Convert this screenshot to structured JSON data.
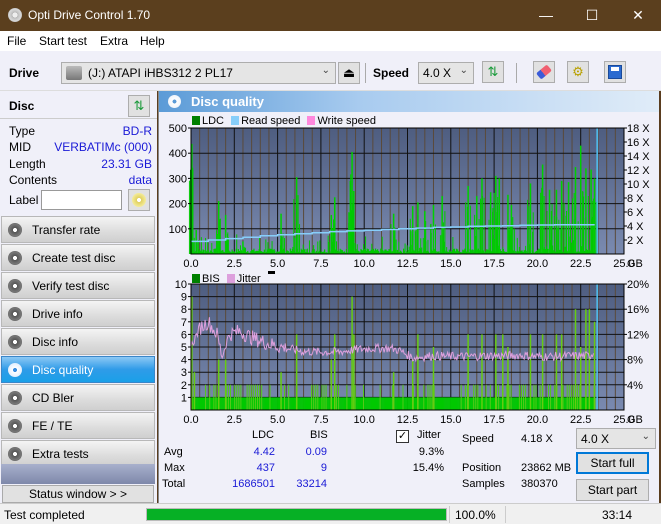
{
  "window": {
    "title": "Opti Drive Control 1.70",
    "controls": {
      "minimize": "—",
      "maximize": "☐",
      "close": "✕"
    }
  },
  "menu": [
    "File",
    "Start test",
    "Extra",
    "Help"
  ],
  "toolbar": {
    "drive_label": "Drive",
    "drive_value": "(J:)  ATAPI iHBS312   2 PL17",
    "eject_icon": "⏏",
    "speed_label": "Speed",
    "speed_value": "4.0 X",
    "icons": [
      "refresh-icon",
      "eraser-icon",
      "settings-icon",
      "save-icon"
    ]
  },
  "disc": {
    "header": "Disc",
    "rows": [
      {
        "key": "Type",
        "value": "BD-R"
      },
      {
        "key": "MID",
        "value": "VERBATIMc (000)"
      },
      {
        "key": "Length",
        "value": "23.31 GB"
      },
      {
        "key": "Contents",
        "value": "data"
      }
    ],
    "label_key": "Label",
    "label_value": ""
  },
  "nav": [
    {
      "label": "Transfer rate",
      "active": false
    },
    {
      "label": "Create test disc",
      "active": false
    },
    {
      "label": "Verify test disc",
      "active": false
    },
    {
      "label": "Drive info",
      "active": false
    },
    {
      "label": "Disc info",
      "active": false
    },
    {
      "label": "Disc quality",
      "active": true
    },
    {
      "label": "CD Bler",
      "active": false
    },
    {
      "label": "FE / TE",
      "active": false
    },
    {
      "label": "Extra tests",
      "active": false
    }
  ],
  "status_window_button": "Status window > >",
  "panel": {
    "title": "Disc quality",
    "legend_top": [
      {
        "label": "LDC",
        "color": "#008000"
      },
      {
        "label": "Read speed",
        "color": "#87cefa"
      },
      {
        "label": "Write speed",
        "color": "#ff88dd"
      }
    ],
    "legend_bottom": [
      {
        "label": "BIS",
        "color": "#008000"
      },
      {
        "label": "Jitter",
        "color": "#dda0dd"
      }
    ]
  },
  "chart_data": [
    {
      "type": "bar",
      "title": "LDC / Read speed",
      "xlabel": "GB",
      "x_ticks": [
        "0.0",
        "2.5",
        "5.0",
        "7.5",
        "10.0",
        "12.5",
        "15.0",
        "17.5",
        "20.0",
        "22.5",
        "25.0"
      ],
      "xlim": [
        0,
        25
      ],
      "ylim": [
        0,
        500
      ],
      "y_ticks": [
        "100",
        "200",
        "300",
        "400",
        "500"
      ],
      "y2_ticks": [
        "2 X",
        "4 X",
        "6 X",
        "8 X",
        "10 X",
        "12 X",
        "14 X",
        "16 X",
        "18 X"
      ],
      "y2lim": [
        0,
        18
      ],
      "grid": true,
      "series": [
        {
          "name": "LDC",
          "color": "#00c800",
          "peaks": [
            [
              0.05,
              437
            ],
            [
              0.3,
              95
            ],
            [
              1.6,
              210
            ],
            [
              2.0,
              155
            ],
            [
              3.0,
              50
            ],
            [
              5.2,
              160
            ],
            [
              6.1,
              305
            ],
            [
              8.1,
              155
            ],
            [
              8.3,
              225
            ],
            [
              9.2,
              290
            ],
            [
              9.3,
              405
            ],
            [
              9.4,
              250
            ],
            [
              11.7,
              160
            ],
            [
              12.8,
              190
            ],
            [
              13.1,
              205
            ],
            [
              13.5,
              170
            ],
            [
              14.0,
              195
            ],
            [
              14.5,
              230
            ],
            [
              16.0,
              270
            ],
            [
              16.5,
              230
            ],
            [
              16.8,
              300
            ],
            [
              17.3,
              245
            ],
            [
              17.6,
              310
            ],
            [
              17.8,
              300
            ],
            [
              18.3,
              235
            ],
            [
              18.5,
              195
            ],
            [
              19.6,
              280
            ],
            [
              20.3,
              355
            ],
            [
              20.7,
              255
            ],
            [
              21.1,
              255
            ],
            [
              21.4,
              290
            ],
            [
              21.8,
              285
            ],
            [
              22.2,
              345
            ],
            [
              22.5,
              430
            ],
            [
              22.8,
              340
            ],
            [
              23.1,
              335
            ],
            [
              23.3,
              300
            ]
          ],
          "baseline": 10
        },
        {
          "name": "Read speed",
          "color": "#87cefa",
          "unit": "X",
          "x": [
            0,
            1,
            2,
            3,
            4,
            5,
            6,
            7,
            8,
            9,
            10,
            11,
            12,
            13,
            14,
            15,
            16,
            17,
            18,
            19,
            20,
            21,
            22,
            23.31
          ],
          "values": [
            1.8,
            2.0,
            2.2,
            2.4,
            2.6,
            2.75,
            2.9,
            3.05,
            3.2,
            3.3,
            3.4,
            3.5,
            3.6,
            3.7,
            3.8,
            3.85,
            3.95,
            4.0,
            4.05,
            4.1,
            4.15,
            4.18,
            4.18,
            4.2
          ]
        }
      ]
    },
    {
      "type": "bar",
      "title": "BIS / Jitter",
      "xlabel": "GB",
      "x_ticks": [
        "0.0",
        "2.5",
        "5.0",
        "7.5",
        "10.0",
        "12.5",
        "15.0",
        "17.5",
        "20.0",
        "22.5",
        "25.0"
      ],
      "xlim": [
        0,
        25
      ],
      "ylim": [
        0,
        10
      ],
      "y_ticks": [
        "1",
        "2",
        "3",
        "4",
        "5",
        "6",
        "7",
        "8",
        "9",
        "10"
      ],
      "y2_ticks": [
        "4%",
        "8%",
        "12%",
        "16%",
        "20%"
      ],
      "y2lim": [
        0,
        20
      ],
      "grid": true,
      "series": [
        {
          "name": "BIS",
          "color": "#00c800",
          "peaks": [
            [
              0.05,
              9
            ],
            [
              0.2,
              3
            ],
            [
              1.6,
              4
            ],
            [
              2.0,
              4
            ],
            [
              5.2,
              3
            ],
            [
              6.1,
              6
            ],
            [
              8.1,
              4
            ],
            [
              8.3,
              6
            ],
            [
              9.3,
              9
            ],
            [
              9.4,
              6
            ],
            [
              11.7,
              3
            ],
            [
              12.8,
              4
            ],
            [
              13.1,
              6
            ],
            [
              14.0,
              5
            ],
            [
              16.0,
              6
            ],
            [
              16.8,
              6
            ],
            [
              17.6,
              6
            ],
            [
              18.0,
              6
            ],
            [
              18.3,
              5
            ],
            [
              19.6,
              6
            ],
            [
              20.3,
              6
            ],
            [
              21.1,
              6
            ],
            [
              21.4,
              6
            ],
            [
              22.2,
              8
            ],
            [
              22.5,
              5
            ],
            [
              22.8,
              8
            ],
            [
              23.0,
              8
            ],
            [
              23.3,
              7
            ]
          ],
          "baseline": 1
        },
        {
          "name": "Jitter",
          "color": "#dda0dd",
          "unit": "%",
          "x": [
            0,
            0.5,
            1.0,
            1.5,
            1.8,
            2.2,
            2.8,
            3.5,
            4.5,
            5.5,
            6.5,
            7.5,
            8.5,
            9.5,
            10.5,
            11.5,
            12.0,
            12.8,
            14,
            15,
            16,
            17,
            18,
            19,
            20,
            21,
            22,
            23,
            23.3
          ],
          "values": [
            10,
            13,
            14,
            12,
            8.5,
            12,
            12.5,
            11.5,
            10.5,
            9.8,
            9.3,
            9.2,
            9.2,
            9.6,
            9.8,
            9.8,
            9.5,
            8.3,
            8.6,
            8.5,
            8.5,
            8.6,
            8.6,
            8.7,
            8.5,
            8.5,
            8.6,
            8.6,
            9.2
          ]
        }
      ]
    }
  ],
  "stats": {
    "columns": [
      "LDC",
      "BIS"
    ],
    "rows": [
      {
        "label": "Avg",
        "ldc": "4.42",
        "bis": "0.09",
        "jitter": "9.3%"
      },
      {
        "label": "Max",
        "ldc": "437",
        "bis": "9",
        "jitter": "15.4%"
      },
      {
        "label": "Total",
        "ldc": "1686501",
        "bis": "33214"
      }
    ],
    "jitter_label": "Jitter",
    "jitter_checked": true,
    "speed_label": "Speed",
    "speed_value": "4.18 X",
    "position_label": "Position",
    "position_value": "23862 MB",
    "samples_label": "Samples",
    "samples_value": "380370",
    "speed_select": "4.0 X",
    "start_full": "Start full",
    "start_part": "Start part"
  },
  "statusbar": {
    "status": "Test completed",
    "progress": 100.0,
    "progress_text": "100.0%",
    "elapsed": "33:14"
  }
}
